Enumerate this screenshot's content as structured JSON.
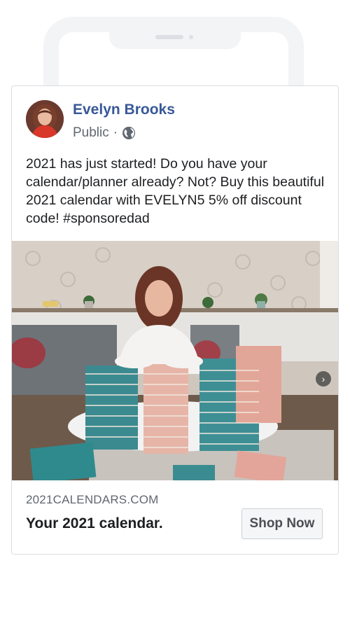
{
  "post": {
    "author_name": "Evelyn Brooks",
    "audience_label": "Public",
    "audience_separator": "·",
    "text": "2021 has just started! Do you have your calendar/planner already? Not? Buy this beautiful 2021 calendar with EVELYN5 5% off discount code! #sponsoredad"
  },
  "cta": {
    "domain": "2021CALENDARS.COM",
    "headline": "Your 2021 calendar.",
    "button_label": "Shop Now"
  },
  "icons": {
    "audience": "globe-icon",
    "carousel_next": "chevron-right-icon"
  },
  "colors": {
    "author_name": "#385898",
    "secondary_text": "#606770",
    "primary_text": "#1c1e21",
    "button_bg": "#f5f6f7"
  }
}
